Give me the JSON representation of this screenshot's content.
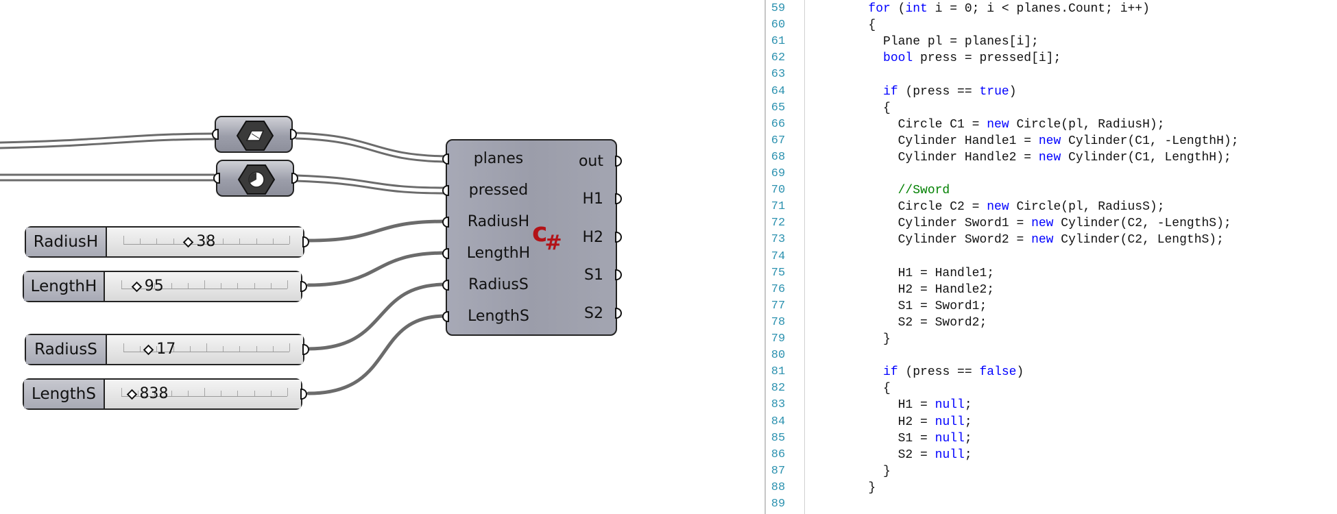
{
  "canvas": {
    "icon_components": [
      {
        "name": "plane-param-icon"
      },
      {
        "name": "boolean-param-icon"
      }
    ],
    "sliders": [
      {
        "name": "RadiusH",
        "value": "38",
        "position": 0.39
      },
      {
        "name": "LengthH",
        "value": "95",
        "position": 0.09
      },
      {
        "name": "RadiusS",
        "value": "17",
        "position": 0.15
      },
      {
        "name": "LengthS",
        "value": "838",
        "position": 0.06
      }
    ],
    "script_component": {
      "logo": "C#",
      "inputs": [
        "planes",
        "pressed",
        "RadiusH",
        "LengthH",
        "RadiusS",
        "LengthS"
      ],
      "outputs": [
        "out",
        "H1",
        "H2",
        "S1",
        "S2"
      ]
    }
  },
  "editor": {
    "colors": {
      "keyword": "#0000ff",
      "comment": "#008000",
      "line_number": "#2b91af"
    },
    "lines": [
      {
        "n": "59",
        "text": "        for (int i = 0; i < planes.Count; i++)"
      },
      {
        "n": "60",
        "text": "        {"
      },
      {
        "n": "61",
        "text": "          Plane pl = planes[i];"
      },
      {
        "n": "62",
        "text": "          bool press = pressed[i];"
      },
      {
        "n": "63",
        "text": ""
      },
      {
        "n": "64",
        "text": "          if (press == true)"
      },
      {
        "n": "65",
        "text": "          {"
      },
      {
        "n": "66",
        "text": "            Circle C1 = new Circle(pl, RadiusH);"
      },
      {
        "n": "67",
        "text": "            Cylinder Handle1 = new Cylinder(C1, -LengthH);"
      },
      {
        "n": "68",
        "text": "            Cylinder Handle2 = new Cylinder(C1, LengthH);"
      },
      {
        "n": "69",
        "text": ""
      },
      {
        "n": "70",
        "text": "            //Sword"
      },
      {
        "n": "71",
        "text": "            Circle C2 = new Circle(pl, RadiusS);"
      },
      {
        "n": "72",
        "text": "            Cylinder Sword1 = new Cylinder(C2, -LengthS);"
      },
      {
        "n": "73",
        "text": "            Cylinder Sword2 = new Cylinder(C2, LengthS);"
      },
      {
        "n": "74",
        "text": ""
      },
      {
        "n": "75",
        "text": "            H1 = Handle1;"
      },
      {
        "n": "76",
        "text": "            H2 = Handle2;"
      },
      {
        "n": "77",
        "text": "            S1 = Sword1;"
      },
      {
        "n": "78",
        "text": "            S2 = Sword2;"
      },
      {
        "n": "79",
        "text": "          }"
      },
      {
        "n": "80",
        "text": ""
      },
      {
        "n": "81",
        "text": "          if (press == false)"
      },
      {
        "n": "82",
        "text": "          {"
      },
      {
        "n": "83",
        "text": "            H1 = null;"
      },
      {
        "n": "84",
        "text": "            H2 = null;"
      },
      {
        "n": "85",
        "text": "            S1 = null;"
      },
      {
        "n": "86",
        "text": "            S2 = null;"
      },
      {
        "n": "87",
        "text": "          }"
      },
      {
        "n": "88",
        "text": "        }"
      },
      {
        "n": "89",
        "text": ""
      }
    ]
  }
}
